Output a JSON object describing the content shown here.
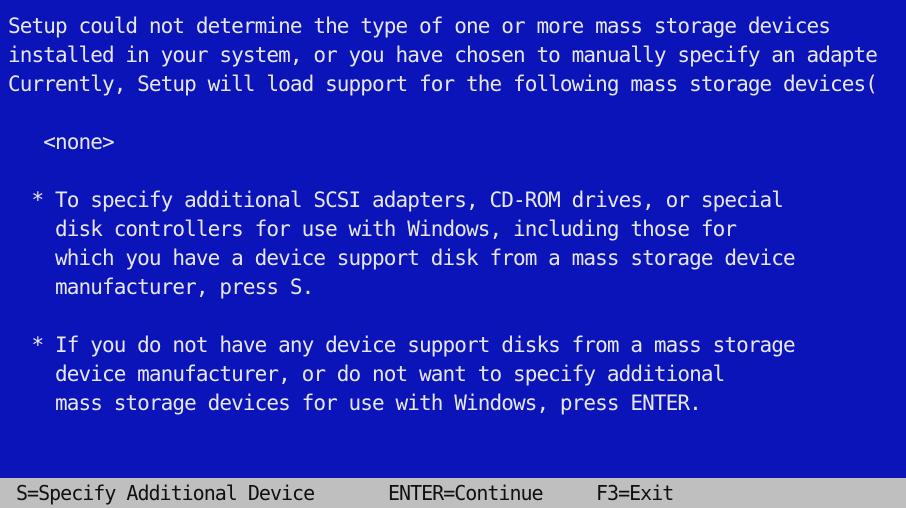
{
  "window": {
    "background": "#0a14b8",
    "text_color": "#e6e6ec",
    "status_bar_background": "#bfbfbf"
  },
  "message": {
    "intro": [
      "Setup could not determine the type of one or more mass storage devices",
      "installed in your system, or you have chosen to manually specify an adapte",
      "Currently, Setup will load support for the following mass storage devices("
    ],
    "device_list_item": "   <none>",
    "option_specify": [
      "  * To specify additional SCSI adapters, CD-ROM drives, or special",
      "    disk controllers for use with Windows, including those for",
      "    which you have a device support disk from a mass storage device",
      "    manufacturer, press S."
    ],
    "option_continue": [
      "  * If you do not have any device support disks from a mass storage",
      "    device manufacturer, or do not want to specify additional",
      "    mass storage devices for use with Windows, press ENTER."
    ]
  },
  "status_bar": {
    "specify": "S=Specify Additional Device",
    "continue": "ENTER=Continue",
    "exit": "F3=Exit"
  }
}
